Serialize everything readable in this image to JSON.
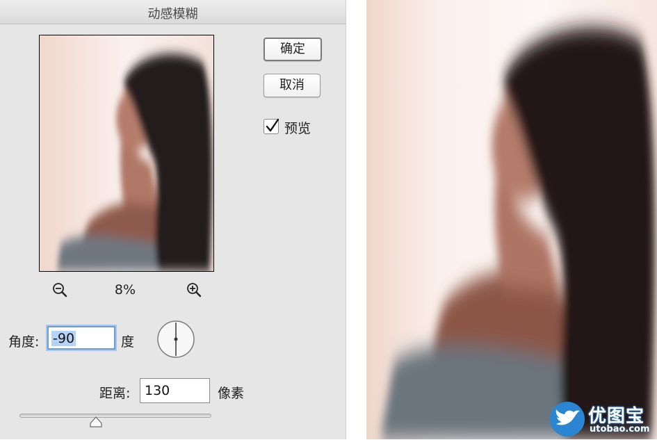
{
  "dialog": {
    "title": "动感模糊",
    "ok_label": "确定",
    "cancel_label": "取消",
    "preview_checked": true,
    "preview_label": "预览",
    "zoom_out_icon": "zoom-out-icon",
    "zoom_in_icon": "zoom-in-icon",
    "zoom_percent": "8%",
    "angle": {
      "label": "角度:",
      "value": "-90",
      "unit": "度"
    },
    "distance": {
      "label": "距离:",
      "value": "130",
      "unit": "像素",
      "slider_fraction": 0.4
    }
  },
  "result_image": {
    "subject": "motion-blurred woman looking left"
  },
  "watermark": {
    "name": "优图宝",
    "url": "utobao.com",
    "logo_icon": "bird-icon",
    "color": "#2a7cc7"
  }
}
